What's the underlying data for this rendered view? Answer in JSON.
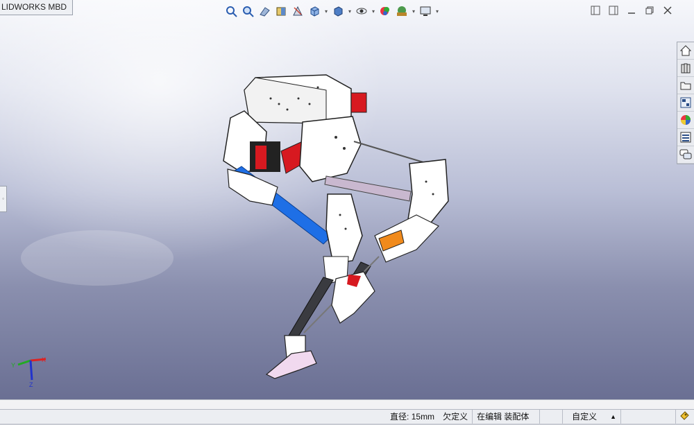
{
  "document_tab": {
    "label": "LIDWORKS MBD"
  },
  "heads_up_toolbar": {
    "items": [
      {
        "name": "zoom-to-fit-icon"
      },
      {
        "name": "zoom-to-area-icon"
      },
      {
        "name": "previous-view-icon"
      },
      {
        "name": "section-view-icon"
      },
      {
        "name": "dynamic-annotation-views-icon"
      },
      {
        "name": "view-orientation-icon",
        "dropdown": true
      },
      {
        "name": "display-style-icon",
        "dropdown": true
      },
      {
        "name": "hide-show-items-icon",
        "dropdown": true
      },
      {
        "name": "edit-appearance-icon"
      },
      {
        "name": "apply-scene-icon",
        "dropdown": true
      },
      {
        "name": "view-settings-icon",
        "dropdown": true
      }
    ]
  },
  "task_pane": {
    "items": [
      {
        "name": "solidworks-resources-icon"
      },
      {
        "name": "design-library-icon"
      },
      {
        "name": "file-explorer-icon"
      },
      {
        "name": "view-palette-icon"
      },
      {
        "name": "appearances-scenes-icon"
      },
      {
        "name": "custom-properties-icon"
      },
      {
        "name": "forum-icon"
      }
    ]
  },
  "status_bar": {
    "diameter": "直径: 15mm",
    "definition": "欠定义",
    "editing": "在编辑 装配体",
    "units": "自定义",
    "arrow": "▲"
  },
  "colors": {
    "viewport_top": "#f6f7fb",
    "viewport_bottom": "#6a6f93",
    "blue_link": "#1e6fe6",
    "servo_red": "#d71920",
    "dark_rod": "#3a3b40",
    "rod_lavender": "#c9b8cf",
    "orange_part": "#f08a1c"
  }
}
